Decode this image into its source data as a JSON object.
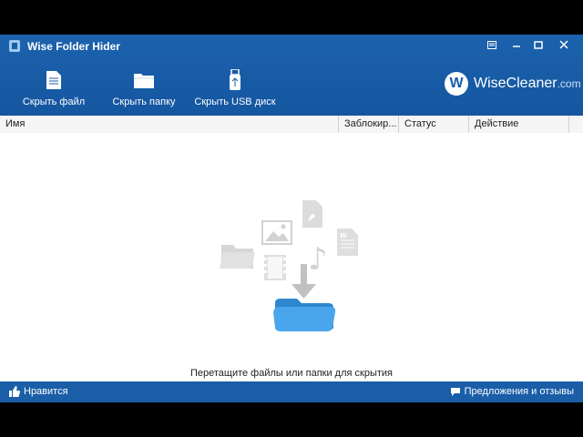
{
  "app": {
    "title": "Wise Folder Hider"
  },
  "toolbar": {
    "hide_file_label": "Скрыть файл",
    "hide_folder_label": "Скрыть папку",
    "hide_usb_label": "Скрыть USB диск"
  },
  "brand": {
    "logo_letter": "W",
    "name": "WiseCleaner",
    "domain": ".com"
  },
  "table": {
    "columns": [
      "Имя",
      "Заблокир...",
      "Статус",
      "Действие"
    ]
  },
  "main": {
    "drop_hint": "Перетащите файлы или папки для скрытия"
  },
  "footer": {
    "like_label": "Нравится",
    "feedback_label": "Предложения и отзывы"
  },
  "colors": {
    "accent": "#1b5ea8",
    "folder": "#3a9be0"
  }
}
